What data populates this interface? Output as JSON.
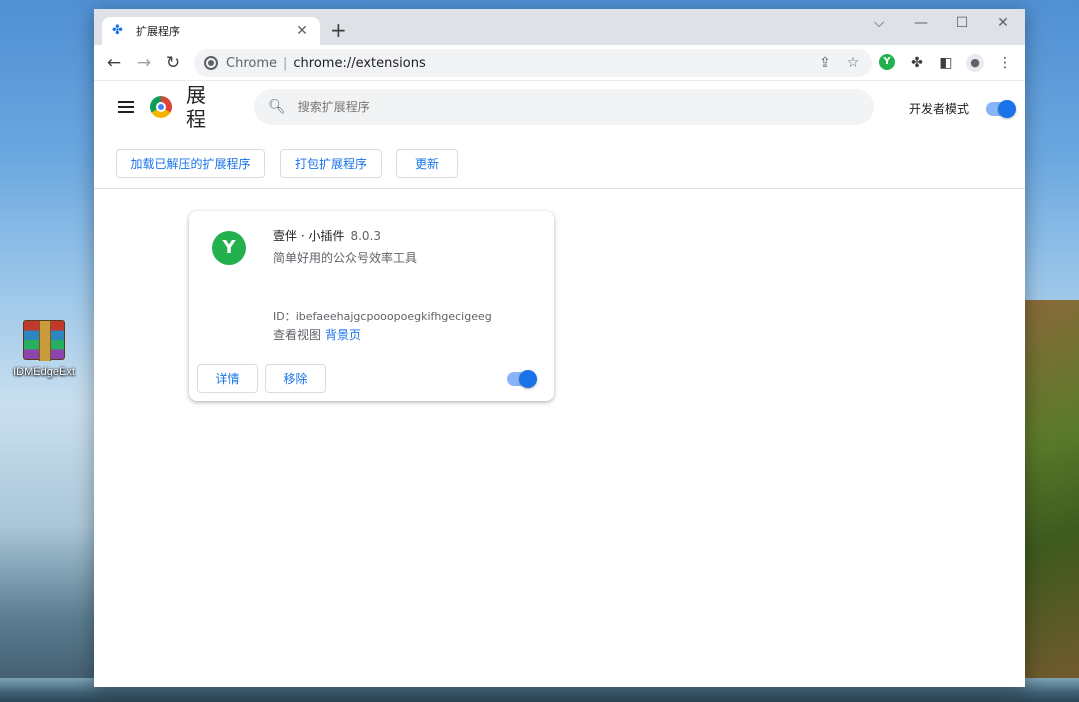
{
  "desktop": {
    "icon_label": "IDMEdgeExt"
  },
  "tab": {
    "title": "扩展程序"
  },
  "omnibox": {
    "site": "Chrome",
    "separator": "|",
    "url": "chrome://extensions"
  },
  "toolbar_icons": {
    "extension_badge": "Y"
  },
  "header": {
    "title": "扩展程序",
    "title_visible": "展程",
    "search_placeholder": "搜索扩展程序",
    "devmode_label": "开发者模式",
    "devmode_on": true
  },
  "actions": {
    "load_unpacked": "加载已解压的扩展程序",
    "pack": "打包扩展程序",
    "update": "更新"
  },
  "extension": {
    "logo_letter": "Y",
    "name": "壹伴 · 小插件",
    "version": "8.0.3",
    "description": "简单好用的公众号效率工具",
    "id_label": "ID：ibefaeehajgcpooopoegkifhgecigeeg",
    "views_label": "查看视图",
    "views_link": "背景页",
    "details_label": "详情",
    "remove_label": "移除",
    "enabled": true
  },
  "colors": {
    "accent": "#1a73e8",
    "extension_green": "#22b14c"
  }
}
